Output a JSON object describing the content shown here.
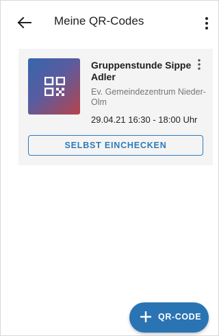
{
  "header": {
    "title": "Meine QR-Codes",
    "back_icon": "arrow-left-icon",
    "menu_icon": "more-vert-icon"
  },
  "card": {
    "title": "Gruppenstunde Sippe Adler",
    "location": "Ev. Gemeindezentrum Nieder-Olm",
    "time": "29.04.21 16:30 - 18:00 Uhr",
    "thumbnail_icon": "qr-code-icon",
    "menu_icon": "more-vert-icon",
    "checkin_label": "SELBST EINCHECKEN"
  },
  "fab": {
    "icon": "plus-icon",
    "label": "QR-CODE"
  },
  "colors": {
    "accent": "#2a74b4",
    "card_bg": "#f4f4f4",
    "thumb_gradient_start": "#3566ad",
    "thumb_gradient_end": "#b5444c"
  }
}
